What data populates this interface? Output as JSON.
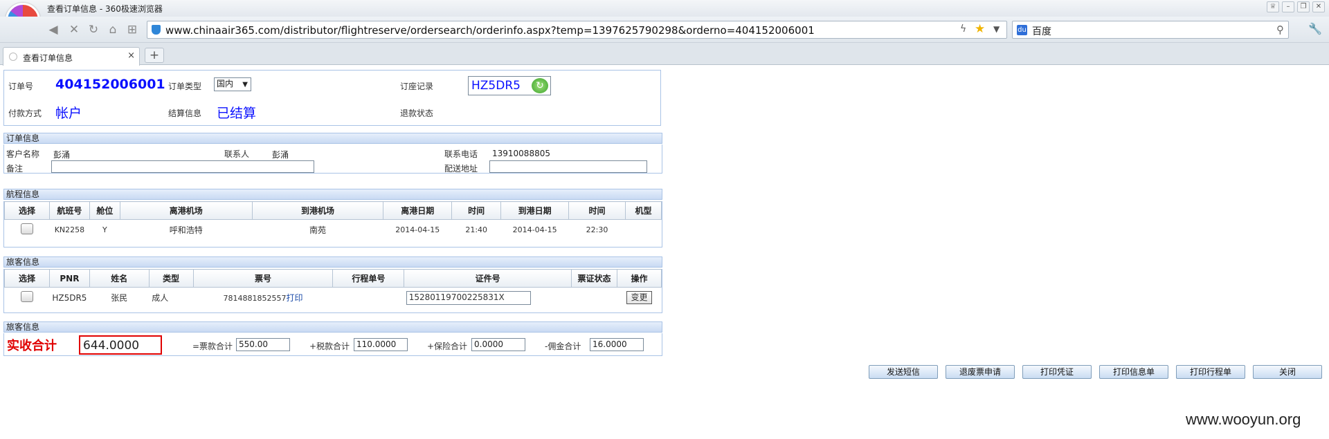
{
  "window": {
    "title": "查看订单信息 - 360极速浏览器"
  },
  "browser": {
    "url": "www.chinaair365.com/distributor/flightreserve/ordersearch/orderinfo.aspx?temp=1397625790298&orderno=404152006001",
    "search_engine": "百度",
    "tab_label": "查看订单信息",
    "tab_close": "×",
    "new_tab": "+"
  },
  "order_header": {
    "order_no_label": "订单号",
    "order_no": "404152006001",
    "order_type_label": "订单类型",
    "order_type": "国内",
    "pnr_label": "订座记录",
    "pnr": "HZ5DR5",
    "pay_method_label": "付款方式",
    "pay_method": "帐户",
    "settle_label": "结算信息",
    "settle_status": "已结算",
    "refund_label": "退款状态",
    "refund_status": ""
  },
  "order_info": {
    "section_title": "订单信息",
    "customer_label": "客户名称",
    "customer": "彭涌",
    "contact_label": "联系人",
    "contact": "彭涌",
    "phone_label": "联系电话",
    "phone": "13910088805",
    "remark_label": "备注",
    "remark": "",
    "address_label": "配送地址",
    "address": ""
  },
  "flight_info": {
    "section_title": "航程信息",
    "columns": [
      "选择",
      "航班号",
      "舱位",
      "离港机场",
      "到港机场",
      "离港日期",
      "时间",
      "到港日期",
      "时间",
      "机型"
    ],
    "rows": [
      {
        "flight_no": "KN2258",
        "cabin": "Y",
        "depart_airport": "呼和浩特",
        "arrive_airport": "南苑",
        "depart_date": "2014-04-15",
        "depart_time": "21:40",
        "arrive_date": "2014-04-15",
        "arrive_time": "22:30",
        "aircraft": ""
      }
    ]
  },
  "passenger_info": {
    "section_title": "旅客信息",
    "columns": [
      "选择",
      "PNR",
      "姓名",
      "类型",
      "票号",
      "行程单号",
      "证件号",
      "票证状态",
      "操作"
    ],
    "rows": [
      {
        "pnr": "HZ5DR5",
        "name": "张民",
        "type": "成人",
        "ticket_no": "7814881852557",
        "print_link": "打印",
        "itinerary_no": "",
        "id_no": "15280119700225831X",
        "ticket_status": "",
        "action": "变更"
      }
    ]
  },
  "payment_info": {
    "section_title": "旅客信息",
    "total_label": "实收合计",
    "total": "644.0000",
    "fare_label": "=票款合计",
    "fare": "550.00",
    "tax_label": "+税款合计",
    "tax": "110.0000",
    "insurance_label": "+保险合计",
    "insurance": "0.0000",
    "commission_label": "-佣金合计",
    "commission": "16.0000"
  },
  "actions": [
    "发送短信",
    "退废票申请",
    "打印凭证",
    "打印信息单",
    "打印行程单",
    "关闭"
  ],
  "watermark": "www.wooyun.org",
  "colors": {
    "accent_blue": "#0a10ff",
    "total_red": "#e00000",
    "section_bg": "#c9daf3"
  }
}
